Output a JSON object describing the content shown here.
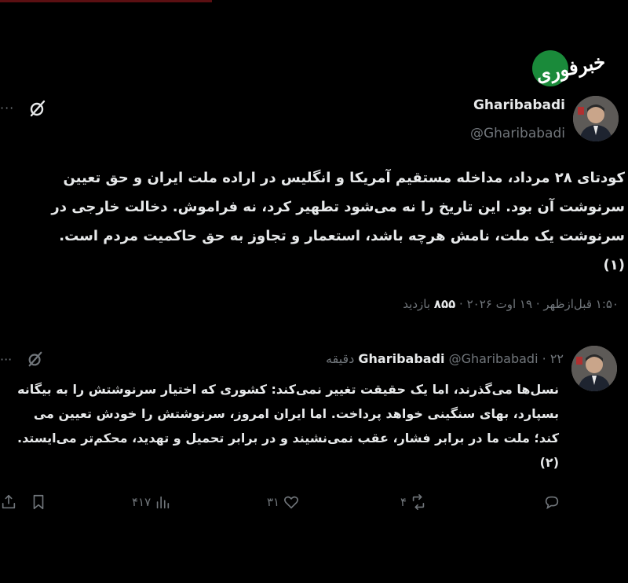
{
  "watermark": {
    "text": "خبرفوری"
  },
  "tweet1": {
    "author_name": "Gharibabadi",
    "author_handle": "@Gharibabadi",
    "more": "···",
    "body": "کودتای ۲۸ مرداد، مداخله مستقیم آمریکا و انگلیس در اراده ملت ایران و حق تعیین\nسرنوشت آن بود. این تاریخ را نه می‌شود تطهیر کرد، نه فراموش. دخالت خارجی در\nسرنوشت یک ملت، نامش هرچه باشد، استعمار و تجاوز به حق حاکمیت مردم است.\n(۱)",
    "time": "۱:۵۰ قبل‌ازظهر",
    "date": "۱۹ اوت ۲۰۲۶",
    "views_count": "۸۵۵",
    "views_label": "بازدید",
    "sep": "·"
  },
  "tweet2": {
    "author_name": "Gharibabadi",
    "author_handle": "@Gharibabadi",
    "time_ago": "۲۲ دقیقه",
    "sep": "·",
    "more": "···",
    "body": "نسل‌ها می‌گذرند، اما یک حقیقت تغییر نمی‌کند: کشوری که اختیار سرنوشتش را به بیگانه\nبسپارد، بهای سنگینی خواهد پرداخت. اما ایران امروز، سرنوشتش را خودش تعیین می\nکند؛ ملت ما در برابر فشار، عقب نمی‌نشیند و در برابر تحمیل و تهدید، محکم‌تر می‌ایستد.\n(۲)",
    "actions": {
      "reposts": "۴",
      "likes": "۳۱",
      "views": "۴۱۷"
    }
  },
  "icons": [
    "grok-icon",
    "more-icon",
    "reply-icon",
    "repost-icon",
    "like-icon",
    "views-icon",
    "bookmark-icon",
    "share-icon"
  ]
}
